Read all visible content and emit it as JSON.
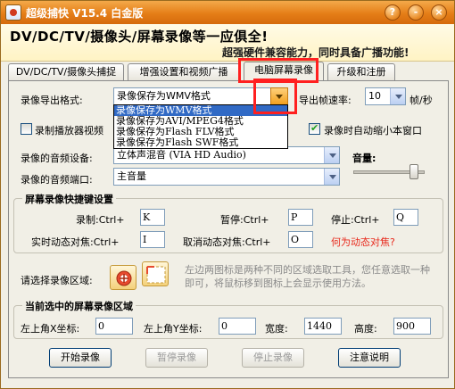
{
  "window": {
    "title": "超级捕快 V15.4 白金版"
  },
  "titlebar_buttons": {
    "help": "?",
    "minimize": "-",
    "close": "×"
  },
  "banner": {
    "line1": "DV/DC/TV/摄像头/屏幕录像等一应俱全!",
    "line2": "超强硬件兼容能力，同时具备广播功能!"
  },
  "tabs": [
    {
      "label": "DV/DC/TV/摄像头捕捉"
    },
    {
      "label": "增强设置和视频广播"
    },
    {
      "label": "电脑屏幕录像"
    },
    {
      "label": "升级和注册"
    }
  ],
  "export": {
    "label": "录像导出格式:",
    "selected": "录像保存为WMV格式",
    "options": [
      "录像保存为WMV格式",
      "录像保存为AVI/MPEG4格式",
      "录像保存为Flash FLV格式",
      "录像保存为Flash SWF格式"
    ]
  },
  "framerate": {
    "label": "导出帧速率:",
    "value": "10",
    "unit": "帧/秒"
  },
  "record_player_video": {
    "label": "录制播放器视频",
    "checked": false
  },
  "auto_minimize": {
    "label": "录像时自动缩小本窗口",
    "checked": true
  },
  "audio_device": {
    "label": "录像的音频设备:",
    "value": "立体声混音 (VIA HD Audio)"
  },
  "audio_port": {
    "label": "录像的音频端口:",
    "value": "主音量"
  },
  "volume": {
    "label": "音量:",
    "level": 0.85
  },
  "hotkeys": {
    "title": "屏幕录像快捷键设置",
    "record": {
      "label": "录制:Ctrl+",
      "value": "K"
    },
    "pause": {
      "label": "暂停:Ctrl+",
      "value": "P"
    },
    "stop": {
      "label": "停止:Ctrl+",
      "value": "Q"
    },
    "focus": {
      "label": "实时动态对焦:Ctrl+",
      "value": "I"
    },
    "cancel_focus": {
      "label": "取消动态对焦:Ctrl+",
      "value": "O"
    },
    "what_is_focus": "何为动态对焦?"
  },
  "region": {
    "label": "请选择录像区域:",
    "hint": "左边两图标是两种不同的区域选取工具，您任意选取一种即可，将鼠标移到图标上会显示使用方法。"
  },
  "current_region": {
    "title": "当前选中的屏幕录像区域",
    "x_label": "左上角X坐标:",
    "x_value": "0",
    "y_label": "左上角Y坐标:",
    "y_value": "0",
    "width_label": "宽度:",
    "width_value": "1440",
    "height_label": "高度:",
    "height_value": "900"
  },
  "buttons": {
    "start": "开始录像",
    "pause": "暂停录像",
    "stop": "停止录像",
    "notes": "注意说明"
  },
  "colors": {
    "accent": "#e57e17",
    "highlight": "#ff2020",
    "link": "#e8281b"
  }
}
